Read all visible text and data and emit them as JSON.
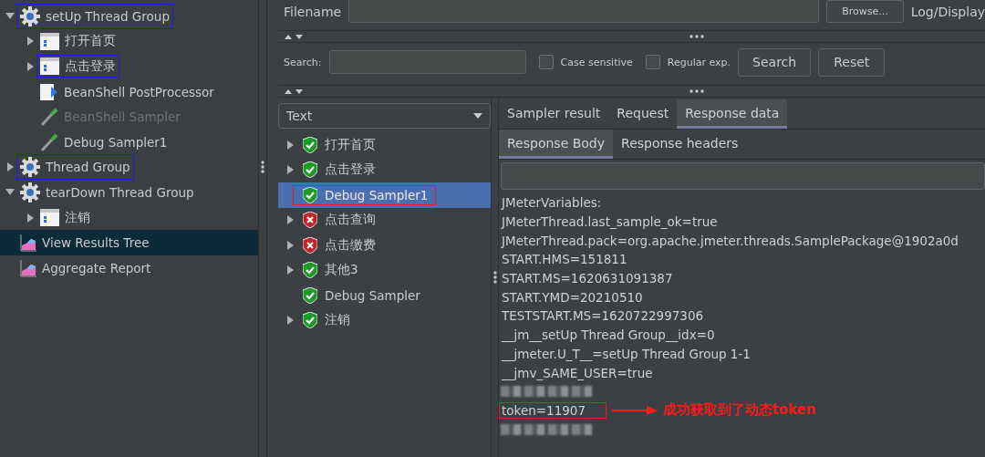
{
  "test_plan": {
    "items": [
      {
        "label": "setUp Thread Group",
        "kind": "thread-group",
        "expanded": true,
        "highlighted": true,
        "disabled": false,
        "selected": false,
        "children": [
          {
            "label": "打开首页",
            "kind": "controller",
            "expanded": false,
            "highlighted": false,
            "disabled": false,
            "selected": false
          },
          {
            "label": "点击登录",
            "kind": "controller",
            "expanded": false,
            "highlighted": true,
            "disabled": false,
            "selected": false
          },
          {
            "label": "BeanShell PostProcessor",
            "kind": "postprocessor",
            "highlighted": false,
            "disabled": false,
            "selected": false
          },
          {
            "label": "BeanShell Sampler",
            "kind": "sampler",
            "highlighted": false,
            "disabled": true,
            "selected": false
          },
          {
            "label": "Debug Sampler1",
            "kind": "sampler",
            "highlighted": false,
            "disabled": false,
            "selected": false
          }
        ]
      },
      {
        "label": "Thread Group",
        "kind": "thread-group",
        "expanded": false,
        "highlighted": true,
        "disabled": false,
        "selected": false
      },
      {
        "label": "tearDown Thread Group",
        "kind": "thread-group",
        "expanded": true,
        "highlighted": false,
        "disabled": false,
        "selected": false,
        "children": [
          {
            "label": "注销",
            "kind": "controller",
            "expanded": false,
            "highlighted": false,
            "disabled": false,
            "selected": false
          }
        ]
      },
      {
        "label": "View Results Tree",
        "kind": "listener",
        "highlighted": false,
        "disabled": false,
        "selected": true
      },
      {
        "label": "Aggregate Report",
        "kind": "listener",
        "highlighted": false,
        "disabled": false,
        "selected": false
      }
    ]
  },
  "file_row": {
    "label": "Filename",
    "browse_button": "Browse...",
    "log_label": "Log/Display"
  },
  "search_row": {
    "label": "Search:",
    "case_sensitive": {
      "label": "Case sensitive",
      "checked": false
    },
    "regular_exp": {
      "label": "Regular exp.",
      "checked": false
    },
    "search_button": "Search",
    "reset_button": "Reset"
  },
  "results": {
    "renderer": "Text",
    "items": [
      {
        "label": "打开首页",
        "passed": true,
        "expanded": false,
        "selected": false,
        "highlighted": false
      },
      {
        "label": "点击登录",
        "passed": true,
        "expanded": false,
        "selected": false,
        "highlighted": false
      },
      {
        "label": "Debug Sampler1",
        "passed": true,
        "selected": true,
        "highlighted": true
      },
      {
        "label": "点击查询",
        "passed": false,
        "expanded": false,
        "selected": false,
        "highlighted": false
      },
      {
        "label": "点击缴费",
        "passed": false,
        "expanded": false,
        "selected": false,
        "highlighted": false
      },
      {
        "label": "其他3",
        "passed": true,
        "expanded": false,
        "selected": false,
        "highlighted": false
      },
      {
        "label": "Debug Sampler",
        "passed": true,
        "selected": false,
        "highlighted": false
      },
      {
        "label": "注销",
        "passed": true,
        "expanded": false,
        "selected": false,
        "highlighted": false
      }
    ]
  },
  "detail": {
    "tabs": [
      {
        "label": "Sampler result",
        "selected": false
      },
      {
        "label": "Request",
        "selected": false
      },
      {
        "label": "Response data",
        "selected": true
      }
    ],
    "subtabs": [
      {
        "label": "Response Body",
        "selected": true
      },
      {
        "label": "Response headers",
        "selected": false
      }
    ],
    "lines": [
      {
        "kind": "text",
        "text": "JMeterVariables:"
      },
      {
        "kind": "text",
        "text": "JMeterThread.last_sample_ok=true"
      },
      {
        "kind": "text",
        "text": "JMeterThread.pack=org.apache.jmeter.threads.SamplePackage@1902a0d"
      },
      {
        "kind": "text",
        "text": "START.HMS=151811"
      },
      {
        "kind": "text",
        "text": "START.MS=1620631091387"
      },
      {
        "kind": "text",
        "text": "START.YMD=20210510"
      },
      {
        "kind": "text",
        "text": "TESTSTART.MS=1620722997306"
      },
      {
        "kind": "text",
        "text": "__jm__setUp Thread Group__idx=0"
      },
      {
        "kind": "text",
        "text": "__jmeter.U_T__=setUp Thread Group 1-1"
      },
      {
        "kind": "text",
        "text": "__jmv_SAME_USER=true"
      },
      {
        "kind": "redacted"
      },
      {
        "kind": "text",
        "text": "token=11907",
        "highlighted": true,
        "note": "成功获取到了动态token"
      },
      {
        "kind": "redacted"
      }
    ]
  }
}
